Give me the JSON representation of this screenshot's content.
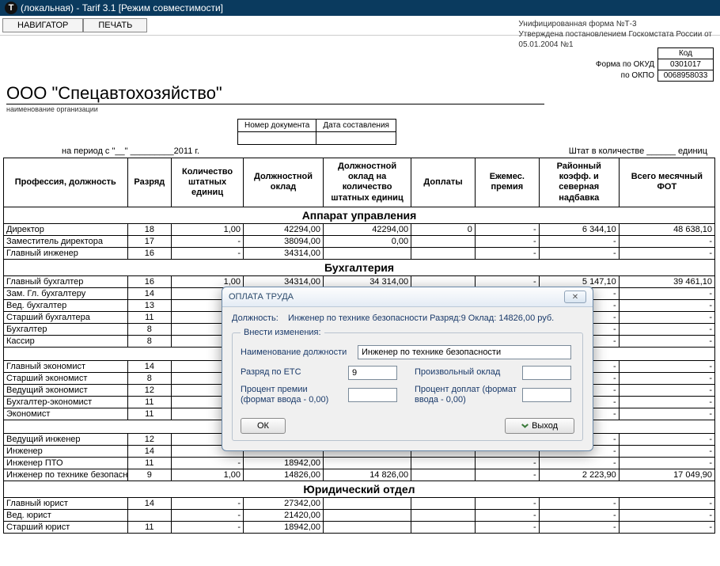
{
  "titlebar": {
    "text": "(локальная) - Tarif 3.1  [Режим совместимости]"
  },
  "toolbar": {
    "navigator": "НАВИГАТОР",
    "print": "ПЕЧАТЬ"
  },
  "meta": {
    "line1": "Унифицированная форма №Т-3",
    "line2": "Утверждена постановлением Госкомстата России от",
    "line3": "05.01.2004 №1"
  },
  "codes": {
    "kod_label": "Код",
    "okud_label": "Форма по ОКУД",
    "okud": "0301017",
    "okpo_label": "по ОКПО",
    "okpo": "0068958033"
  },
  "org": {
    "name": "ООО \"Спецавтохозяйство\"",
    "caption": "наименование организации"
  },
  "docmeta": {
    "doc_num_label": "Номер документа",
    "date_label": "Дата составления"
  },
  "period": {
    "text": "на период  с \"__\" _________2011 г.",
    "staff": "Штат в количестве ______ единиц"
  },
  "headers": [
    "Профессия, должность",
    "Разряд",
    "Количество штатных единиц",
    "Должностной оклад",
    "Должностной оклад на количество штатных единиц",
    "Доплаты",
    "Ежемес. премия",
    "Районный коэфф. и северная надбавка",
    "Всего месячный ФОТ"
  ],
  "sections": [
    {
      "title": "Аппарат управления",
      "rows": [
        {
          "prof": "Директор",
          "razr": "18",
          "qty": "1,00",
          "oklad": "42294,00",
          "oklad_qty": "42294,00",
          "dopl": "0",
          "prem": "-",
          "koeff": "6 344,10",
          "fot": "48 638,10"
        },
        {
          "prof": "Заместитель директора",
          "razr": "17",
          "qty": "-",
          "oklad": "38094,00",
          "oklad_qty": "0,00",
          "dopl": "",
          "prem": "-",
          "koeff": "-",
          "fot": "-"
        },
        {
          "prof": "Главный инженер",
          "razr": "16",
          "qty": "-",
          "oklad": "34314,00",
          "oklad_qty": "",
          "dopl": "",
          "prem": "-",
          "koeff": "-",
          "fot": "-"
        }
      ]
    },
    {
      "title": "Бухгалтерия",
      "rows": [
        {
          "prof": "Главный бухгалтер",
          "razr": "16",
          "qty": "1,00",
          "oklad": "34314,00",
          "oklad_qty": "34 314,00",
          "dopl": "",
          "prem": "-",
          "koeff": "5 147,10",
          "fot": "39 461,10"
        },
        {
          "prof": "Зам. Гл. бухгалтеру",
          "razr": "14",
          "qty": "-",
          "oklad": "",
          "oklad_qty": "",
          "dopl": "",
          "prem": "-",
          "koeff": "-",
          "fot": "-"
        },
        {
          "prof": "Вед. бухгалтер",
          "razr": "13",
          "qty": "",
          "oklad": "",
          "oklad_qty": "",
          "dopl": "",
          "prem": "",
          "koeff": "-",
          "fot": "-"
        },
        {
          "prof": "Старший бухгалтера",
          "razr": "11",
          "qty": "",
          "oklad": "",
          "oklad_qty": "",
          "dopl": "",
          "prem": "",
          "koeff": "-",
          "fot": "-"
        },
        {
          "prof": "Бухгалтер",
          "razr": "8",
          "qty": "",
          "oklad": "",
          "oklad_qty": "",
          "dopl": "",
          "prem": "",
          "koeff": "-",
          "fot": "-"
        },
        {
          "prof": "Кассир",
          "razr": "8",
          "qty": "",
          "oklad": "",
          "oklad_qty": "",
          "dopl": "",
          "prem": "",
          "koeff": "-",
          "fot": "-"
        }
      ]
    },
    {
      "title": "",
      "rows": [
        {
          "prof": "Главный экономист",
          "razr": "14",
          "qty": "",
          "oklad": "",
          "oklad_qty": "",
          "dopl": "",
          "prem": "",
          "koeff": "-",
          "fot": "-"
        },
        {
          "prof": "Старший экономист",
          "razr": "8",
          "qty": "",
          "oklad": "",
          "oklad_qty": "",
          "dopl": "",
          "prem": "",
          "koeff": "-",
          "fot": "-"
        },
        {
          "prof": "Ведущий экономист",
          "razr": "12",
          "qty": "",
          "oklad": "",
          "oklad_qty": "",
          "dopl": "",
          "prem": "",
          "koeff": "-",
          "fot": "-"
        },
        {
          "prof": "Бухгалтер-экономист",
          "razr": "11",
          "qty": "",
          "oklad": "",
          "oklad_qty": "",
          "dopl": "",
          "prem": "",
          "koeff": "-",
          "fot": "-"
        },
        {
          "prof": "Экономист",
          "razr": "11",
          "qty": "",
          "oklad": "",
          "oklad_qty": "",
          "dopl": "",
          "prem": "",
          "koeff": "-",
          "fot": "-"
        }
      ]
    },
    {
      "title": "",
      "rows": [
        {
          "prof": "Ведущий инженер",
          "razr": "12",
          "qty": "",
          "oklad": "",
          "oklad_qty": "",
          "dopl": "",
          "prem": "",
          "koeff": "-",
          "fot": "-"
        },
        {
          "prof": "Инженер",
          "razr": "14",
          "qty": "",
          "oklad": "",
          "oklad_qty": "",
          "dopl": "",
          "prem": "",
          "koeff": "-",
          "fot": "-"
        },
        {
          "prof": "Инженер ПТО",
          "razr": "11",
          "qty": "-",
          "oklad": "18942,00",
          "oklad_qty": "",
          "dopl": "",
          "prem": "-",
          "koeff": "-",
          "fot": "-"
        },
        {
          "prof": "Инженер по технике безопасности",
          "razr": "9",
          "qty": "1,00",
          "oklad": "14826,00",
          "oklad_qty": "14 826,00",
          "dopl": "",
          "prem": "-",
          "koeff": "2 223,90",
          "fot": "17 049,90"
        }
      ]
    },
    {
      "title": "Юридический отдел",
      "rows": [
        {
          "prof": "Главный юрист",
          "razr": "14",
          "qty": "-",
          "oklad": "27342,00",
          "oklad_qty": "",
          "dopl": "",
          "prem": "-",
          "koeff": "-",
          "fot": "-"
        },
        {
          "prof": "Вед. юрист",
          "razr": "",
          "qty": "-",
          "oklad": "21420,00",
          "oklad_qty": "",
          "dopl": "",
          "prem": "-",
          "koeff": "-",
          "fot": "-"
        },
        {
          "prof": "Старший юрист",
          "razr": "11",
          "qty": "-",
          "oklad": "18942,00",
          "oklad_qty": "",
          "dopl": "",
          "prem": "-",
          "koeff": "-",
          "fot": "-"
        }
      ]
    }
  ],
  "dialog": {
    "title": "ОПЛАТА ТРУДА",
    "position_label": "Должность:",
    "summary": "Инженер по технике безопасности Разряд:9 Оклад: 14826,00 руб.",
    "fieldset_legend": "Внести изменения:",
    "name_label": "Наименование должности",
    "name_value": "Инженер по технике безопасности",
    "razr_label": "Разряд по ЕТС",
    "razr_value": "9",
    "arbitrary_label": "Произвольный оклад",
    "arbitrary_value": "",
    "bonus_label": "Процент премии (формат ввода - 0,00)",
    "bonus_value": "",
    "dopl_label": "Процент  доплат (формат ввода - 0,00)",
    "dopl_value": "",
    "ok": "ОК",
    "exit": "Выход"
  }
}
